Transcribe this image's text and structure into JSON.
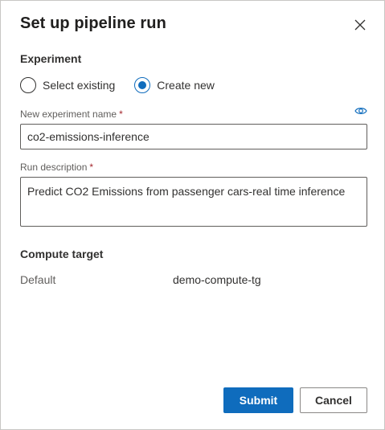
{
  "dialog": {
    "title": "Set up pipeline run"
  },
  "experiment": {
    "section_label": "Experiment",
    "options": [
      {
        "label": "Select existing",
        "selected": false
      },
      {
        "label": "Create new",
        "selected": true
      }
    ],
    "name_field": {
      "label": "New experiment name",
      "required_mark": "*",
      "value": "co2-emissions-inference"
    },
    "description_field": {
      "label": "Run description",
      "required_mark": "*",
      "value": "Predict CO2 Emissions from passenger cars-real time inference"
    }
  },
  "compute": {
    "section_label": "Compute target",
    "key": "Default",
    "value": "demo-compute-tg"
  },
  "buttons": {
    "submit": "Submit",
    "cancel": "Cancel"
  },
  "colors": {
    "accent": "#0f6cbd",
    "required": "#a4262c",
    "text": "#323130"
  },
  "icons": {
    "close": "close-icon",
    "eye": "eye-icon"
  }
}
